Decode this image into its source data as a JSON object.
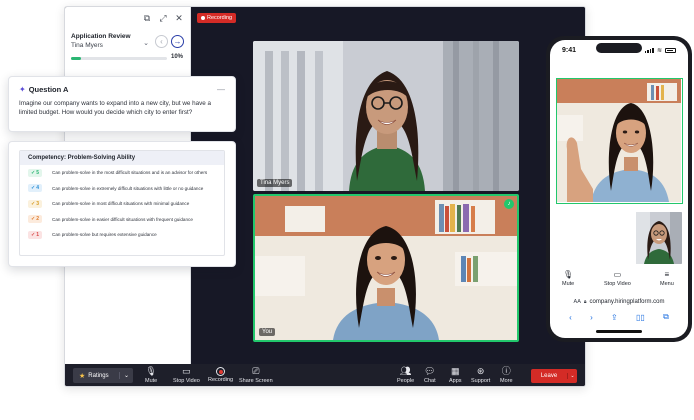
{
  "side_panel": {
    "title": "Application Review",
    "candidate": "Tina Myers",
    "progress_label": "10%",
    "progress_value": 0.1
  },
  "question_card": {
    "title": "Question A",
    "text": "Imagine our company wants to expand into a new city, but we have a limited budget. How would you decide which city to enter first?"
  },
  "competency_card": {
    "title": "Competency: Problem-Solving Ability",
    "rows": [
      {
        "rating": "5",
        "color": "#2bb673",
        "bg": "#e3f6ec",
        "description": "Can problem-solve in the most difficult situations and is an advisor for others"
      },
      {
        "rating": "4",
        "color": "#2b8fd6",
        "bg": "#e2f0fb",
        "description": "Can problem-solve in extremely difficult situations with little or no guidance"
      },
      {
        "rating": "3",
        "color": "#d79a1e",
        "bg": "#fbf1dd",
        "description": "Can problem-solve in most difficult situations with minimal guidance"
      },
      {
        "rating": "2",
        "color": "#e07a2b",
        "bg": "#fcebdd",
        "description": "Can problem-solve in easier difficult situations with frequent guidance"
      },
      {
        "rating": "1",
        "color": "#d94a4a",
        "bg": "#fbe3e3",
        "description": "Can problem-solve but requires extensive guidance"
      }
    ]
  },
  "meeting": {
    "recording_label": "Recording",
    "top_tile_name": "Tina Myers",
    "bottom_tile_name": "You"
  },
  "toolbar": {
    "ratings_label": "Ratings",
    "mute": "Mute",
    "stop_video": "Stop Video",
    "recording": "Recording",
    "share_screen": "Share Screen",
    "people": "People",
    "chat": "Chat",
    "apps": "Apps",
    "support": "Support",
    "more": "More",
    "leave": "Leave"
  },
  "phone": {
    "time": "9:41",
    "mute": "Mute",
    "stop_video": "Stop Video",
    "menu": "Menu",
    "aa": "AA",
    "url": "company.hiringplatform.com"
  },
  "colors": {
    "accent_green": "#22c76c",
    "leave_red": "#d42b26",
    "nav_blue": "#2a3ea8",
    "toolbar_bg": "#1e1f2a"
  }
}
